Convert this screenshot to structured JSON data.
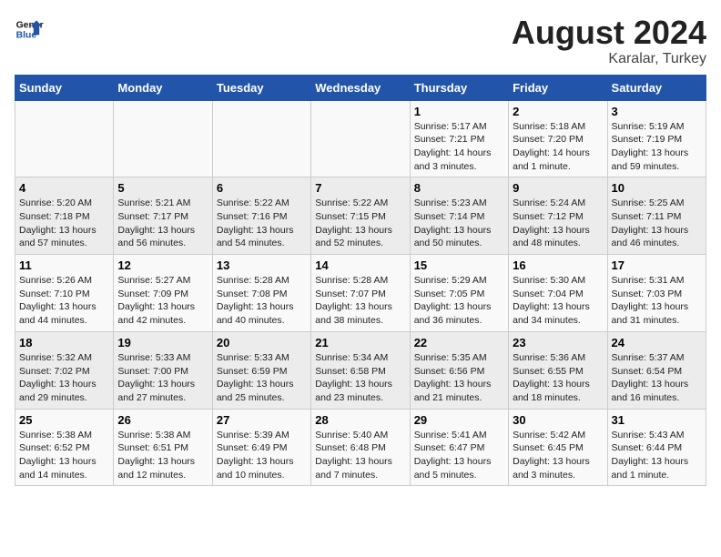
{
  "header": {
    "logo_general": "General",
    "logo_blue": "Blue",
    "month_year": "August 2024",
    "location": "Karalar, Turkey"
  },
  "days_of_week": [
    "Sunday",
    "Monday",
    "Tuesday",
    "Wednesday",
    "Thursday",
    "Friday",
    "Saturday"
  ],
  "weeks": [
    [
      {
        "day": "",
        "info": ""
      },
      {
        "day": "",
        "info": ""
      },
      {
        "day": "",
        "info": ""
      },
      {
        "day": "",
        "info": ""
      },
      {
        "day": "1",
        "info": "Sunrise: 5:17 AM\nSunset: 7:21 PM\nDaylight: 14 hours\nand 3 minutes."
      },
      {
        "day": "2",
        "info": "Sunrise: 5:18 AM\nSunset: 7:20 PM\nDaylight: 14 hours\nand 1 minute."
      },
      {
        "day": "3",
        "info": "Sunrise: 5:19 AM\nSunset: 7:19 PM\nDaylight: 13 hours\nand 59 minutes."
      }
    ],
    [
      {
        "day": "4",
        "info": "Sunrise: 5:20 AM\nSunset: 7:18 PM\nDaylight: 13 hours\nand 57 minutes."
      },
      {
        "day": "5",
        "info": "Sunrise: 5:21 AM\nSunset: 7:17 PM\nDaylight: 13 hours\nand 56 minutes."
      },
      {
        "day": "6",
        "info": "Sunrise: 5:22 AM\nSunset: 7:16 PM\nDaylight: 13 hours\nand 54 minutes."
      },
      {
        "day": "7",
        "info": "Sunrise: 5:22 AM\nSunset: 7:15 PM\nDaylight: 13 hours\nand 52 minutes."
      },
      {
        "day": "8",
        "info": "Sunrise: 5:23 AM\nSunset: 7:14 PM\nDaylight: 13 hours\nand 50 minutes."
      },
      {
        "day": "9",
        "info": "Sunrise: 5:24 AM\nSunset: 7:12 PM\nDaylight: 13 hours\nand 48 minutes."
      },
      {
        "day": "10",
        "info": "Sunrise: 5:25 AM\nSunset: 7:11 PM\nDaylight: 13 hours\nand 46 minutes."
      }
    ],
    [
      {
        "day": "11",
        "info": "Sunrise: 5:26 AM\nSunset: 7:10 PM\nDaylight: 13 hours\nand 44 minutes."
      },
      {
        "day": "12",
        "info": "Sunrise: 5:27 AM\nSunset: 7:09 PM\nDaylight: 13 hours\nand 42 minutes."
      },
      {
        "day": "13",
        "info": "Sunrise: 5:28 AM\nSunset: 7:08 PM\nDaylight: 13 hours\nand 40 minutes."
      },
      {
        "day": "14",
        "info": "Sunrise: 5:28 AM\nSunset: 7:07 PM\nDaylight: 13 hours\nand 38 minutes."
      },
      {
        "day": "15",
        "info": "Sunrise: 5:29 AM\nSunset: 7:05 PM\nDaylight: 13 hours\nand 36 minutes."
      },
      {
        "day": "16",
        "info": "Sunrise: 5:30 AM\nSunset: 7:04 PM\nDaylight: 13 hours\nand 34 minutes."
      },
      {
        "day": "17",
        "info": "Sunrise: 5:31 AM\nSunset: 7:03 PM\nDaylight: 13 hours\nand 31 minutes."
      }
    ],
    [
      {
        "day": "18",
        "info": "Sunrise: 5:32 AM\nSunset: 7:02 PM\nDaylight: 13 hours\nand 29 minutes."
      },
      {
        "day": "19",
        "info": "Sunrise: 5:33 AM\nSunset: 7:00 PM\nDaylight: 13 hours\nand 27 minutes."
      },
      {
        "day": "20",
        "info": "Sunrise: 5:33 AM\nSunset: 6:59 PM\nDaylight: 13 hours\nand 25 minutes."
      },
      {
        "day": "21",
        "info": "Sunrise: 5:34 AM\nSunset: 6:58 PM\nDaylight: 13 hours\nand 23 minutes."
      },
      {
        "day": "22",
        "info": "Sunrise: 5:35 AM\nSunset: 6:56 PM\nDaylight: 13 hours\nand 21 minutes."
      },
      {
        "day": "23",
        "info": "Sunrise: 5:36 AM\nSunset: 6:55 PM\nDaylight: 13 hours\nand 18 minutes."
      },
      {
        "day": "24",
        "info": "Sunrise: 5:37 AM\nSunset: 6:54 PM\nDaylight: 13 hours\nand 16 minutes."
      }
    ],
    [
      {
        "day": "25",
        "info": "Sunrise: 5:38 AM\nSunset: 6:52 PM\nDaylight: 13 hours\nand 14 minutes."
      },
      {
        "day": "26",
        "info": "Sunrise: 5:38 AM\nSunset: 6:51 PM\nDaylight: 13 hours\nand 12 minutes."
      },
      {
        "day": "27",
        "info": "Sunrise: 5:39 AM\nSunset: 6:49 PM\nDaylight: 13 hours\nand 10 minutes."
      },
      {
        "day": "28",
        "info": "Sunrise: 5:40 AM\nSunset: 6:48 PM\nDaylight: 13 hours\nand 7 minutes."
      },
      {
        "day": "29",
        "info": "Sunrise: 5:41 AM\nSunset: 6:47 PM\nDaylight: 13 hours\nand 5 minutes."
      },
      {
        "day": "30",
        "info": "Sunrise: 5:42 AM\nSunset: 6:45 PM\nDaylight: 13 hours\nand 3 minutes."
      },
      {
        "day": "31",
        "info": "Sunrise: 5:43 AM\nSunset: 6:44 PM\nDaylight: 13 hours\nand 1 minute."
      }
    ]
  ]
}
